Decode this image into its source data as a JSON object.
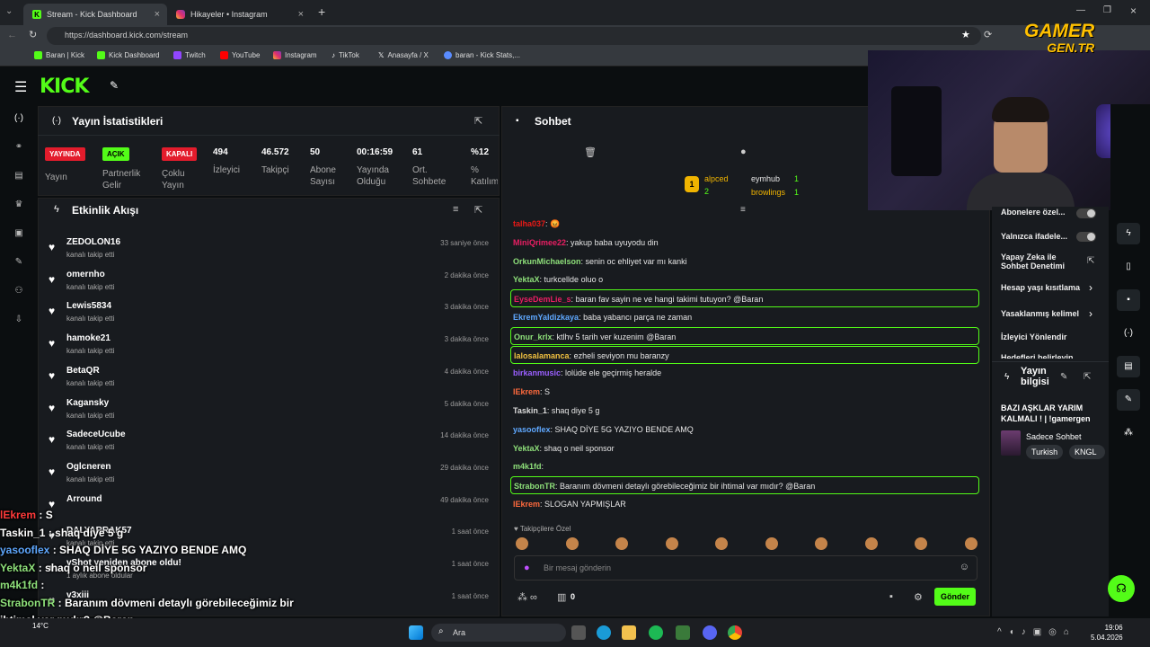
{
  "browser": {
    "tabs": [
      {
        "title": "Stream - Kick Dashboard",
        "active": true
      },
      {
        "title": "Hikayeler • Instagram",
        "active": false
      }
    ],
    "url": "https://dashboard.kick.com/stream",
    "bookmarks": [
      "Baran | Kick",
      "Kick Dashboard",
      "Twitch",
      "YouTube",
      "Instagram",
      "TikTok",
      "Anasayfa / X",
      "baran - Kick Stats,..."
    ]
  },
  "watermark": {
    "line1": "GAMER",
    "line2": "GEN.TR"
  },
  "stats_panel": {
    "title": "Yayın İstatistikleri",
    "items": [
      {
        "badge": "YAYINDA",
        "label": "Yayın"
      },
      {
        "badge": "AÇIK",
        "label": "Partnerlik Gelir"
      },
      {
        "badge": "KAPALI",
        "label": "Çoklu Yayın"
      },
      {
        "value": "494",
        "label": "İzleyici"
      },
      {
        "value": "46.572",
        "label": "Takipçi"
      },
      {
        "value": "50",
        "label": "Abone Sayısı"
      },
      {
        "value": "00:16:59",
        "label": "Yayında Olduğu"
      },
      {
        "value": "61",
        "label": "Ort. Sohbete"
      },
      {
        "value": "%12",
        "label": "% Katılım"
      }
    ]
  },
  "activity": {
    "title": "Etkinlik Akışı",
    "rows": [
      {
        "name": "ZEDOLON16",
        "sub": "kanalı takip etti",
        "time": "33 saniye önce"
      },
      {
        "name": "omernho",
        "sub": "kanalı takip etti",
        "time": "2 dakika önce"
      },
      {
        "name": "Lewis5834",
        "sub": "kanalı takip etti",
        "time": "3 dakika önce"
      },
      {
        "name": "hamoke21",
        "sub": "kanalı takip etti",
        "time": "3 dakika önce"
      },
      {
        "name": "BetaQR",
        "sub": "kanalı takip etti",
        "time": "4 dakika önce"
      },
      {
        "name": "Kagansky",
        "sub": "kanalı takip etti",
        "time": "5 dakika önce"
      },
      {
        "name": "SadeceUcube",
        "sub": "kanalı takip etti",
        "time": "14 dakika önce"
      },
      {
        "name": "Oglcneren",
        "sub": "kanalı takip etti",
        "time": "29 dakika önce"
      },
      {
        "name": "Arround",
        "sub": "",
        "time": "49 dakika önce"
      },
      {
        "name": "DALYARRAK57",
        "sub": "kanalı takip etti",
        "time": "1 saat önce"
      },
      {
        "name": "vShot yeniden abone oldu!",
        "sub": "1 aylık abone oldular",
        "time": "1 saat önce"
      },
      {
        "name": "v3xiii",
        "sub": "",
        "time": "1 saat önce"
      }
    ]
  },
  "chat": {
    "title": "Sohbet",
    "top_users": [
      {
        "rank": "1",
        "name": "alpced",
        "count": "2"
      },
      {
        "name": "eymhub",
        "count": "1"
      },
      {
        "name": "browlings",
        "count": "1"
      }
    ],
    "messages": [
      {
        "user": "talha037",
        "text": "😡",
        "color": "#e91916",
        "hl": false
      },
      {
        "user": "MiniQrimee22",
        "text": "yakup baba uyuyodu din",
        "color": "#e91e63",
        "hl": false
      },
      {
        "user": "OrkunMichaelson",
        "text": "senin oc ehliyet var mı kanki",
        "color": "#8ee07a",
        "hl": false
      },
      {
        "user": "YektaX",
        "text": "turkcellde oluo o",
        "color": "#8ee07a",
        "hl": false
      },
      {
        "user": "EyseDemLie_s",
        "text": "baran fav sayin ne ve hangi takimi tutuyon? @Baran",
        "color": "#e91e63",
        "hl": true
      },
      {
        "user": "EkremYaldizkaya",
        "text": "baba yabancı parça ne zaman",
        "color": "#5fa8ff",
        "hl": false
      },
      {
        "user": "Onur_krlx",
        "text": "ktlhv 5 tarih ver kuzenim @Baran",
        "color": "#8ee07a",
        "hl": true
      },
      {
        "user": "lalosalamanca",
        "text": "ezheli seviyon mu baranzy",
        "color": "#f0c040",
        "hl": true
      },
      {
        "user": "birkanmusic",
        "text": "lolüde ele geçirmiş heralde",
        "color": "#9a5fff",
        "hl": false
      },
      {
        "user": "lEkrem",
        "text": "S",
        "color": "#ff6a3d",
        "hl": false
      },
      {
        "user": "Taskin_1",
        "text": "shaq diye 5 g",
        "color": "#dddddd",
        "hl": false
      },
      {
        "user": "yasooflex",
        "text": "SHAQ DİYE 5G YAZIYO BENDE AMQ",
        "color": "#5fa8ff",
        "hl": false
      },
      {
        "user": "YektaX",
        "text": "shaq o neil sponsor",
        "color": "#8ee07a",
        "hl": false
      },
      {
        "user": "m4k1fd",
        "text": "",
        "color": "#8ee07a",
        "hl": false
      },
      {
        "user": "StrabonTR",
        "text": "Baranım dövmeni detaylı görebileceğimiz bir ihtimal var mıdır? @Baran",
        "color": "#8ee07a",
        "hl": true
      },
      {
        "user": "lEkrem",
        "text": "SLOGAN YAPMIŞLAR",
        "color": "#ff6a3d",
        "hl": false
      }
    ],
    "emote_section": "Takipçilere Özel",
    "input_placeholder": "Bir mesaj gönderin",
    "send_label": "Gönder",
    "points": "0"
  },
  "settings": {
    "items": [
      "Abonelere özel...",
      "Yalnızca ifadele...",
      "Yapay Zeka ile Sohbet Denetimi",
      "Hesap yaşı kısıtlama",
      "Yasaklanmış kelimel",
      "İzleyici Yönlendir",
      "Hedefleri belirleyin"
    ],
    "stream_info_title": "Yayın bilgisi",
    "stream_title": "BAZI AŞKLAR YARIM KALMALI ! | !gamergen",
    "category": "Sadece Sohbet",
    "tags": [
      "Turkish",
      "KNGL"
    ]
  },
  "overlay_chat": [
    {
      "user": "lEkrem",
      "text": "S",
      "color": "#ff3a3a"
    },
    {
      "user": "Taskin_1",
      "text": "shaq diye 5 g",
      "color": "#ffffff"
    },
    {
      "user": "yasooflex",
      "text": "SHAQ DİYE 5G YAZIYO BENDE AMQ",
      "color": "#5fa8ff"
    },
    {
      "user": "YektaX",
      "text": "shaq o neil sponsor",
      "color": "#8ee07a"
    },
    {
      "user": "m4k1fd",
      "text": "",
      "color": "#8ee07a"
    },
    {
      "user": "StrabonTR",
      "text": "Baranım dövmeni detaylı görebileceğimiz bir",
      "color": "#8ee07a"
    },
    {
      "user": "",
      "text": "ihtimal var mıdır? @Baran",
      "color": "#ffffff"
    },
    {
      "user": "krem",
      "text": "SLOGAN YAPMIŞLAR",
      "color": "#ff3a3a"
    }
  ],
  "taskbar": {
    "search": "Ara",
    "time": "19:06",
    "date": "5.04.2026",
    "temp": "14°C"
  }
}
